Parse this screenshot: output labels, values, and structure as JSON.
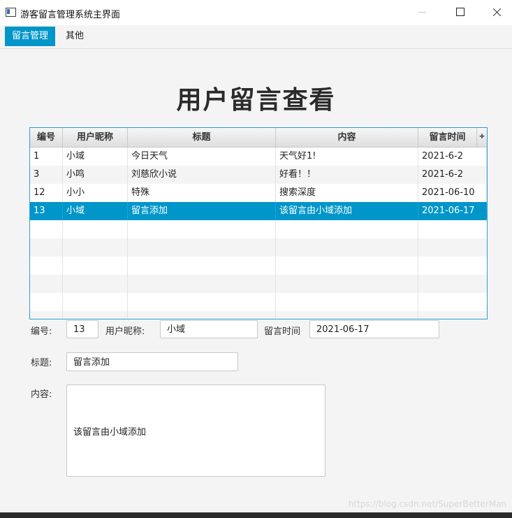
{
  "window": {
    "title": "游客留言管理系统主界面"
  },
  "menubar": {
    "items": [
      {
        "label": "留言管理"
      },
      {
        "label": "其他"
      }
    ]
  },
  "page": {
    "title": "用户留言查看"
  },
  "table": {
    "columns": [
      "编号",
      "用户昵称",
      "标题",
      "内容",
      "留言时间"
    ],
    "rows": [
      {
        "id": "1",
        "nickname": "小域",
        "title": "今日天气",
        "content": "天气好1!",
        "time": "2021-6-2"
      },
      {
        "id": "3",
        "nickname": "小鸣",
        "title": "刘慈欣小说",
        "content": "好看！！",
        "time": "2021-6-2"
      },
      {
        "id": "12",
        "nickname": "小小",
        "title": "特殊",
        "content": "搜索深度",
        "time": "2021-06-10"
      },
      {
        "id": "13",
        "nickname": "小域",
        "title": "留言添加",
        "content": "该留言由小域添加",
        "time": "2021-06-17"
      }
    ],
    "selected_row": "13"
  },
  "form": {
    "id_label": "编号:",
    "id_value": "13",
    "nickname_label": "用户昵称:",
    "nickname_value": "小域",
    "time_label": "留言时间",
    "time_value": "2021-06-17",
    "title_label": "标题:",
    "title_value": "留言添加",
    "content_label": "内容:",
    "content_value": "该留言由小域添加"
  },
  "watermark": "https://blog.csdn.net/SuperBetterMan",
  "colors": {
    "accent": "#0096c9",
    "table_border": "#2a9fd6"
  }
}
